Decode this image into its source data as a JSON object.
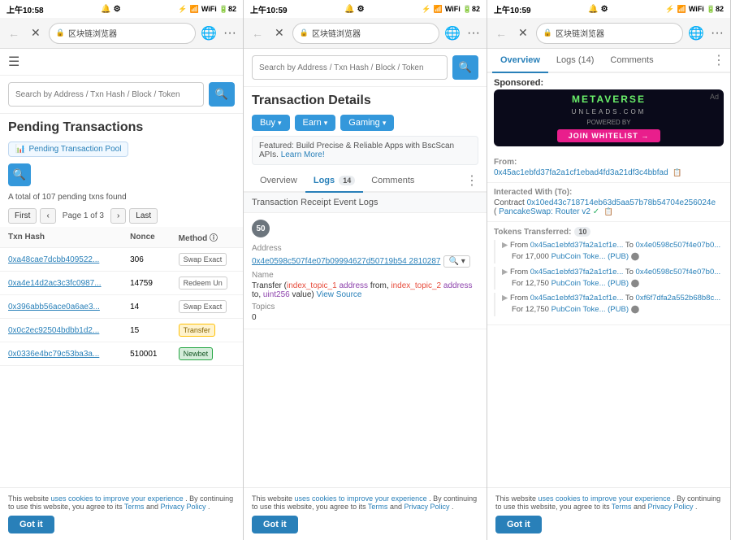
{
  "panel1": {
    "statusBar": {
      "time": "上午10:58",
      "icons": "🔔 ⚙",
      "signal": "🔵📶 WiFi",
      "battery": "82"
    },
    "browserBar": {
      "back": "←",
      "close": "✕",
      "urlLabel": "区块链浏览器",
      "globe": "🌐",
      "menu": "···"
    },
    "searchPlaceholder": "Search by Address / Txn Hash / Block / Token",
    "title": "Pending Transactions",
    "tagChip": "Pending Transaction Pool",
    "resultCount": "A total of 107 pending txns found",
    "pagination": {
      "first": "First",
      "prev": "‹",
      "pageInfo": "Page 1 of 3",
      "next": "›",
      "last": "Last"
    },
    "tableHeaders": [
      "Txn Hash",
      "Nonce",
      "Method ⓘ"
    ],
    "rows": [
      {
        "hash": "0xa48cae7dcbb409522...",
        "nonce": "306",
        "method": "Swap Exact",
        "methodClass": ""
      },
      {
        "hash": "0xa4e14d2ac3c3fc0987...",
        "nonce": "14759",
        "method": "Redeem Un",
        "methodClass": ""
      },
      {
        "hash": "0x396abb56ace0a6ae3...",
        "nonce": "14",
        "method": "Swap Exact",
        "methodClass": ""
      },
      {
        "hash": "0x0c2ec92504bdbb1d2...",
        "nonce": "15",
        "method": "Transfer",
        "methodClass": "method-transfer"
      },
      {
        "hash": "0x0336e4bc79c53ba3a...",
        "nonce": "510001",
        "method": "Newbet",
        "methodClass": "method-newbet"
      }
    ],
    "cookie": {
      "text1": "This website ",
      "link1": "uses cookies to improve your experience",
      "text2": ". By continuing to use this website, you agree to its ",
      "link2": "Terms",
      "text3": " and ",
      "link3": "Privacy Policy",
      "text4": ".",
      "gotIt": "Got it"
    }
  },
  "panel2": {
    "statusBar": {
      "time": "上午10:59",
      "battery": "82"
    },
    "browserBar": {
      "back": "←",
      "close": "✕",
      "urlLabel": "区块链浏览器",
      "globe": "🌐",
      "menu": "···"
    },
    "searchPlaceholder": "Search by Address / Txn Hash / Block / Token",
    "title": "Transaction Details",
    "buttons": [
      "Buy",
      "Earn",
      "Gaming"
    ],
    "featured": {
      "text": "Featured: Build Precise & Reliable Apps with BscScan APIs.",
      "linkText": "Learn More!"
    },
    "tabs": [
      "Overview",
      "Logs (14)",
      "Comments"
    ],
    "activeTab": "Logs (14)",
    "receiptHeader": "Transaction Receipt Event Logs",
    "log": {
      "number": "50",
      "addressLabel": "Address",
      "address": "0x4e0598c507f4e07b09994627d50719b54 2810287",
      "decodeBtn": "🔍 ▾",
      "nameLabel": "Name",
      "nameValue": "Transfer (index_topic_1 address from, index_topic_2 address to, uint256 value)",
      "viewSource": "View Source",
      "topicsLabel": "Topics",
      "topicsValue": "0"
    },
    "cookie": {
      "text1": "This website ",
      "link1": "uses cookies to improve your experience",
      "text2": ". By continuing to use this website, you agree to its ",
      "link2": "Terms",
      "text3": " and ",
      "link3": "Privacy Policy",
      "text4": ".",
      "gotIt": "Got it"
    }
  },
  "panel3": {
    "statusBar": {
      "time": "上午10:59",
      "battery": "82"
    },
    "browserBar": {
      "back": "←",
      "close": "✕",
      "urlLabel": "区块链浏览器",
      "globe": "🌐",
      "menu": "···"
    },
    "tabs": [
      "Overview",
      "Logs (14)",
      "Comments"
    ],
    "activeTab": "Overview",
    "sponsored": "Sponsored:",
    "adTitle": "METAVERSE",
    "adSubtitle": "UNLEADS.COM",
    "adPoweredBy": "POWERED BY",
    "adCta": "JOIN WHITELIST →",
    "fromLabel": "From:",
    "fromAddress": "0x45ac1ebfd37fa2a1cf1ebad4fd3a21df3c4bbfad",
    "interactedLabel": "Interacted With (To):",
    "contractLabel": "Contract",
    "contractAddress": "0x10ed43c718714eb63d5aa57b78b54704e256024e",
    "contractName": "PancakeSwap: Router v2",
    "verifyIcon": "✓",
    "copyIcon": "📋",
    "tokensLabel": "Tokens Transferred:",
    "tokensCount": "10",
    "tokenItems": [
      {
        "arrow": "▶",
        "from": "From",
        "fromAddr": "0x45ac1ebfd37fa2a1cf1e...",
        "to": "To",
        "toAddr": "0x4e0598c507f4e07b0...",
        "amount": "For  17,000",
        "tokenName": "PubCoin Toke... (PUB)"
      },
      {
        "arrow": "▶",
        "from": "From",
        "fromAddr": "0x45ac1ebfd37fa2a1cf1e...",
        "to": "To",
        "toAddr": "0x4e0598c507f4e07b0...",
        "amount": "For  12,750",
        "tokenName": "PubCoin Toke... (PUB)"
      },
      {
        "arrow": "▶",
        "from": "From",
        "fromAddr": "0x45ac1ebfd37fa2a1cf1e...",
        "to": "To",
        "toAddr": "0xf6f7dfa2a552b68b8c...",
        "amount": "For  12,750",
        "tokenName": "PubCoin Toke... (PUB)"
      }
    ],
    "cookie": {
      "text1": "This website ",
      "link1": "uses cookies to improve your experience",
      "text2": ". By continuing to use this website, you agree to its ",
      "link2": "Terms",
      "text3": " and ",
      "link3": "Privacy Policy",
      "text4": ".",
      "gotIt": "Got it"
    }
  }
}
